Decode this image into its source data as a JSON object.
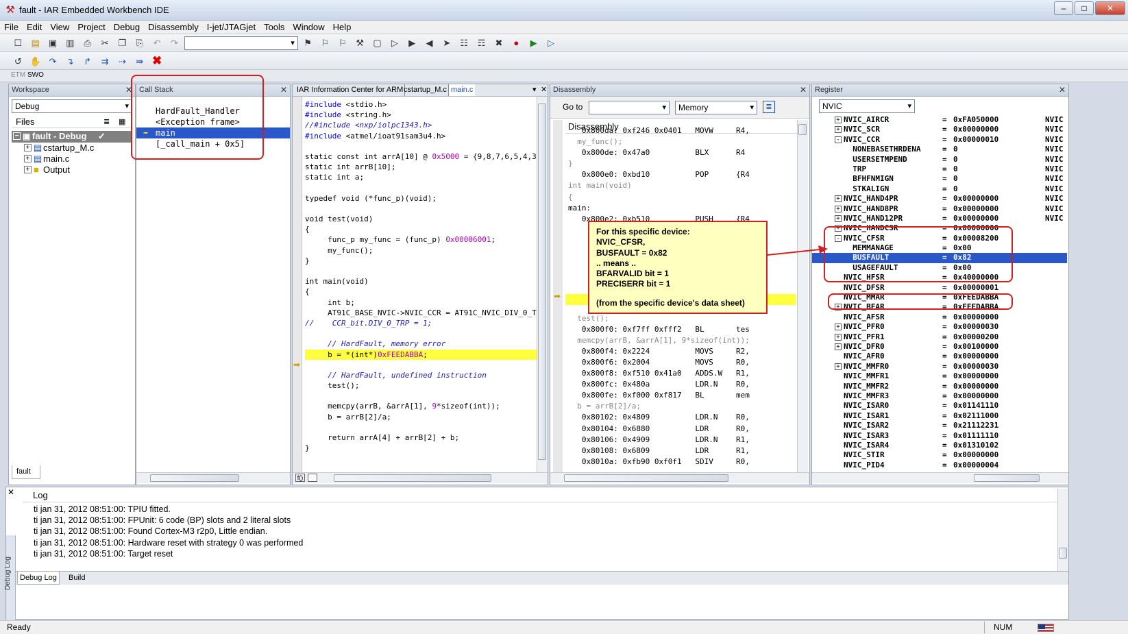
{
  "window": {
    "title": "fault - IAR Embedded Workbench IDE",
    "minimize": "–",
    "maximize": "□",
    "close": "✕"
  },
  "menu": [
    "File",
    "Edit",
    "View",
    "Project",
    "Debug",
    "Disassembly",
    "I-jet/JTAGjet",
    "Tools",
    "Window",
    "Help"
  ],
  "smalltabs": [
    "ETM",
    "SWO"
  ],
  "workspace": {
    "title": "Workspace",
    "config": "Debug",
    "files_header": "Files",
    "tree": [
      {
        "label": "fault - Debug",
        "check": "✓"
      },
      {
        "label": "cstartup_M.c"
      },
      {
        "label": "main.c"
      },
      {
        "label": "Output"
      }
    ],
    "tab": "fault"
  },
  "callstack": {
    "title": "Call Stack",
    "rows": [
      "HardFault_Handler",
      "<Exception frame>",
      "main",
      "[_call_main + 0x5]"
    ]
  },
  "editor": {
    "tabs": [
      "IAR Information Center for ARM",
      "cstartup_M.c",
      "main.c"
    ],
    "lines": [
      [
        "#include",
        " <stdio.h>"
      ],
      [
        "#include",
        " <string.h>"
      ],
      [
        "//#include <nxp/iolpc1343.h>"
      ],
      [
        "#include",
        " <atmel/ioat91sam3u4.h>"
      ],
      [
        ""
      ],
      [
        "static const int arrA[10] @ ",
        "0x5000",
        " = {9,8,7,6,5,4,3,"
      ],
      [
        "static int arrB[10];"
      ],
      [
        "static int a;"
      ],
      [
        ""
      ],
      [
        "typedef void (*func_p)(void);"
      ],
      [
        ""
      ],
      [
        "void test(void)"
      ],
      [
        "{"
      ],
      [
        "     func_p my_func = (func_p) ",
        "0x00006001",
        ";"
      ],
      [
        "     my_func();"
      ],
      [
        "}"
      ],
      [
        ""
      ],
      [
        "int main(void)"
      ],
      [
        "{"
      ],
      [
        "     int b;"
      ],
      [
        "     AT91C_BASE_NVIC->NVIC_CCR = AT91C_NVIC_DIV_0_TR"
      ],
      [
        "//    CCR_bit.DIV_0_TRP = 1;"
      ],
      [
        ""
      ],
      [
        "     // HardFault, memory error"
      ],
      [
        "     b = *(int*)",
        "0xFEEDABBA",
        ";"
      ],
      [
        ""
      ],
      [
        "     // HardFault, undefined instruction"
      ],
      [
        "     test();"
      ],
      [
        ""
      ],
      [
        "     memcpy(arrB, &arrA[1], ",
        "9",
        "*sizeof(int));"
      ],
      [
        "     b = arrB[2]/a;"
      ],
      [
        ""
      ],
      [
        "     return arrA[4] + arrB[2] + b;"
      ],
      [
        "}"
      ]
    ]
  },
  "disassembly": {
    "title": "Disassembly",
    "goto_label": "Go to",
    "memory_combo": "Memory",
    "inner_header": "Disassembly",
    "lines": [
      "   0x800da: 0xf246 0x0401   MOVW     R4,",
      "  my_func();",
      "   0x800de: 0x47a0          BLX      R4",
      "}",
      "   0x800e0: 0xbd10          POP      {R4",
      "int main(void)",
      "{",
      "main:",
      "   0x800e2: 0xb510          PUSH     {R4",
      "                                     NVIC_",
      "                                     R0,",
      "                                     R1,",
      "                                     R1,",
      "",
      "                                     R0,",
      "                                     R0,",
      "                                     R4,",
      "  test();",
      "   0x800f0: 0xf7ff 0xfff2   BL       tes",
      "  memcpy(arrB, &arrA[1], 9*sizeof(int));",
      "   0x800f4: 0x2224          MOVS     R2,",
      "   0x800f6: 0x2004          MOVS     R0,",
      "   0x800f8: 0xf510 0x41a0   ADDS.W   R1,",
      "   0x800fc: 0x480a          LDR.N    R0,",
      "   0x800fe: 0xf000 0xf817   BL       mem",
      "  b = arrB[2]/a;",
      "   0x80102: 0x4809          LDR.N    R0,",
      "   0x80104: 0x6880          LDR      R0,",
      "   0x80106: 0x4909          LDR.N    R1,",
      "   0x80108: 0x6809          LDR      R1,",
      "   0x8010a: 0xfb90 0xf0f1   SDIV     R0,"
    ]
  },
  "register": {
    "title": "Register",
    "group": "NVIC",
    "rows": [
      {
        "exp": "+",
        "name": "NVIC_AIRCR",
        "val": "0xFA050000",
        "x": "NVIC"
      },
      {
        "exp": "+",
        "name": "NVIC_SCR",
        "val": "0x00000000",
        "x": "NVIC"
      },
      {
        "exp": "-",
        "name": "NVIC_CCR",
        "val": "0x00000010",
        "x": "NVIC"
      },
      {
        "exp": "",
        "name": "  NONEBASETHRDENA",
        "val": "0",
        "x": "NVIC"
      },
      {
        "exp": "",
        "name": "  USERSETMPEND",
        "val": "0",
        "x": "NVIC"
      },
      {
        "exp": "",
        "name": "  TRP",
        "val": "0",
        "x": "NVIC"
      },
      {
        "exp": "",
        "name": "  BFHFNMIGN",
        "val": "0",
        "x": "NVIC"
      },
      {
        "exp": "",
        "name": "  STKALIGN",
        "val": "0",
        "x": "NVIC"
      },
      {
        "exp": "+",
        "name": "NVIC_HAND4PR",
        "val": "0x00000000",
        "x": "NVIC"
      },
      {
        "exp": "+",
        "name": "NVIC_HAND8PR",
        "val": "0x00000000",
        "x": "NVIC"
      },
      {
        "exp": "+",
        "name": "NVIC_HAND12PR",
        "val": "0x00000000",
        "x": "NVIC"
      },
      {
        "exp": "+",
        "name": "NVIC_HANDCSR",
        "val": "0x00000000",
        "x": ""
      },
      {
        "exp": "-",
        "name": "NVIC_CFSR",
        "val": "0x00008200",
        "x": ""
      },
      {
        "exp": "",
        "name": "  MEMMANAGE",
        "val": "0x00",
        "x": ""
      },
      {
        "exp": "",
        "name": "  BUSFAULT",
        "val": "0x82",
        "x": "",
        "selected": true
      },
      {
        "exp": "",
        "name": "  USAGEFAULT",
        "val": "0x00",
        "x": ""
      },
      {
        "exp": "",
        "name": "NVIC_HFSR",
        "val": "0x40000000",
        "x": ""
      },
      {
        "exp": "",
        "name": "NVIC_DFSR",
        "val": "0x00000001",
        "x": ""
      },
      {
        "exp": "",
        "name": "NVIC_MMAR",
        "val": "0xFEEDABBA",
        "x": ""
      },
      {
        "exp": "+",
        "name": "NVIC_BFAR",
        "val": "0xFEEDABBA",
        "x": ""
      },
      {
        "exp": "",
        "name": "NVIC_AFSR",
        "val": "0x00000000",
        "x": ""
      },
      {
        "exp": "+",
        "name": "NVIC_PFR0",
        "val": "0x00000030",
        "x": ""
      },
      {
        "exp": "+",
        "name": "NVIC_PFR1",
        "val": "0x00000200",
        "x": ""
      },
      {
        "exp": "+",
        "name": "NVIC_DFR0",
        "val": "0x00100000",
        "x": ""
      },
      {
        "exp": "",
        "name": "NVIC_AFR0",
        "val": "0x00000000",
        "x": ""
      },
      {
        "exp": "+",
        "name": "NVIC_MMFR0",
        "val": "0x00000030",
        "x": ""
      },
      {
        "exp": "",
        "name": "NVIC_MMFR1",
        "val": "0x00000000",
        "x": ""
      },
      {
        "exp": "",
        "name": "NVIC_MMFR2",
        "val": "0x00000000",
        "x": ""
      },
      {
        "exp": "",
        "name": "NVIC_MMFR3",
        "val": "0x00000000",
        "x": ""
      },
      {
        "exp": "",
        "name": "NVIC_ISAR0",
        "val": "0x01141110",
        "x": ""
      },
      {
        "exp": "",
        "name": "NVIC_ISAR1",
        "val": "0x02111000",
        "x": ""
      },
      {
        "exp": "",
        "name": "NVIC_ISAR2",
        "val": "0x21112231",
        "x": ""
      },
      {
        "exp": "",
        "name": "NVIC_ISAR3",
        "val": "0x01111110",
        "x": ""
      },
      {
        "exp": "",
        "name": "NVIC_ISAR4",
        "val": "0x01310102",
        "x": ""
      },
      {
        "exp": "",
        "name": "NVIC_STIR",
        "val": "0x00000000",
        "x": ""
      },
      {
        "exp": "",
        "name": "NVIC_PID4",
        "val": "0x00000004",
        "x": ""
      }
    ]
  },
  "note": {
    "lines": [
      "For this specific device:",
      "NVIC_CFSR,",
      "BUSFAULT = 0x82",
      ".. means ..",
      "BFARVALID bit = 1",
      "PRECISERR bit = 1",
      "",
      "(from the specific device's data sheet)"
    ]
  },
  "log": {
    "header": "Log",
    "lines": [
      "ti jan 31, 2012 08:51:00: TPIU fitted.",
      "ti jan 31, 2012 08:51:00:  FPUnit: 6 code (BP) slots and 2 literal slots",
      "ti jan 31, 2012 08:51:00: Found Cortex-M3 r2p0, Little endian.",
      "ti jan 31, 2012 08:51:00: Hardware reset with strategy 0 was performed",
      "ti jan 31, 2012 08:51:00: Target reset"
    ],
    "side_label": "Debug Log",
    "tabs": [
      "Debug Log",
      "Build"
    ]
  },
  "status": {
    "text": "Ready",
    "num": "NUM"
  },
  "colors": {
    "selection": "#2b58c8",
    "highlight": "#ffff40",
    "annotation": "#d12020",
    "note_bg": "#ffffc0"
  }
}
